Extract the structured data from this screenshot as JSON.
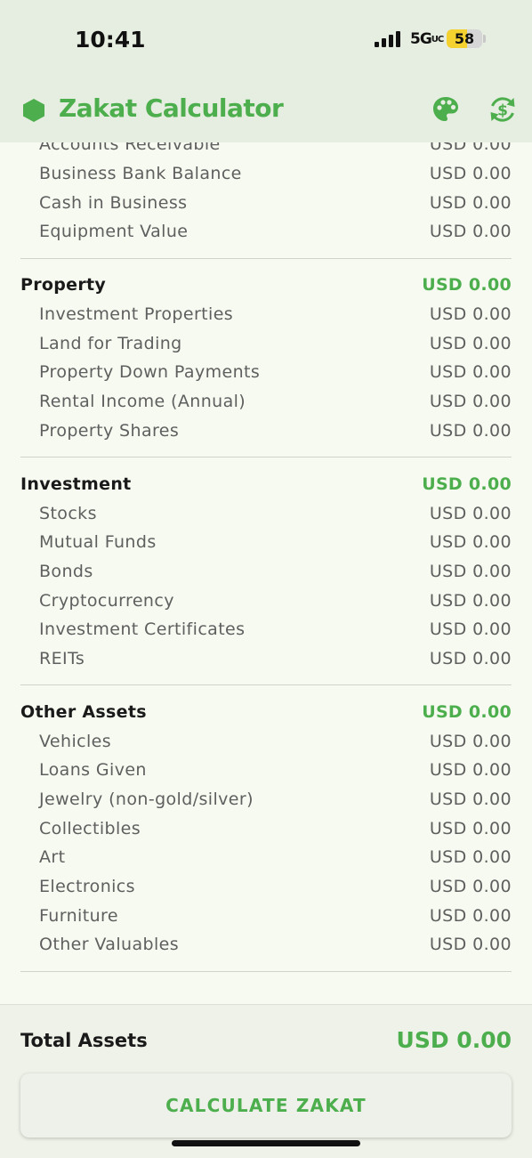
{
  "status_bar": {
    "time": "10:41",
    "network": "5G",
    "network_suffix": "UC",
    "battery": "58",
    "battery_level": 0.58
  },
  "header": {
    "title": "Zakat Calculator",
    "accent": "#4cae4c",
    "icons": [
      "hexagon-icon",
      "palette-icon",
      "currency-swap-icon"
    ]
  },
  "business_items": [
    {
      "label": "Accounts Receivable",
      "value": "USD 0.00"
    },
    {
      "label": "Business Bank Balance",
      "value": "USD 0.00"
    },
    {
      "label": "Cash in Business",
      "value": "USD 0.00"
    },
    {
      "label": "Equipment Value",
      "value": "USD 0.00"
    }
  ],
  "categories": [
    {
      "name": "Property",
      "total": "USD 0.00",
      "items": [
        {
          "label": "Investment Properties",
          "value": "USD 0.00"
        },
        {
          "label": "Land for Trading",
          "value": "USD 0.00"
        },
        {
          "label": "Property Down Payments",
          "value": "USD 0.00"
        },
        {
          "label": "Rental Income (Annual)",
          "value": "USD 0.00"
        },
        {
          "label": "Property Shares",
          "value": "USD 0.00"
        }
      ]
    },
    {
      "name": "Investment",
      "total": "USD 0.00",
      "items": [
        {
          "label": "Stocks",
          "value": "USD 0.00"
        },
        {
          "label": "Mutual Funds",
          "value": "USD 0.00"
        },
        {
          "label": "Bonds",
          "value": "USD 0.00"
        },
        {
          "label": "Cryptocurrency",
          "value": "USD 0.00"
        },
        {
          "label": "Investment Certificates",
          "value": "USD 0.00"
        },
        {
          "label": "REITs",
          "value": "USD 0.00"
        }
      ]
    },
    {
      "name": "Other Assets",
      "total": "USD 0.00",
      "items": [
        {
          "label": "Vehicles",
          "value": "USD 0.00"
        },
        {
          "label": "Loans Given",
          "value": "USD 0.00"
        },
        {
          "label": "Jewelry (non-gold/silver)",
          "value": "USD 0.00"
        },
        {
          "label": "Collectibles",
          "value": "USD 0.00"
        },
        {
          "label": "Art",
          "value": "USD 0.00"
        },
        {
          "label": "Electronics",
          "value": "USD 0.00"
        },
        {
          "label": "Furniture",
          "value": "USD 0.00"
        },
        {
          "label": "Other Valuables",
          "value": "USD 0.00"
        }
      ]
    }
  ],
  "footer": {
    "total_label": "Total Assets",
    "total_value": "USD 0.00",
    "button_label": "CALCULATE ZAKAT"
  }
}
